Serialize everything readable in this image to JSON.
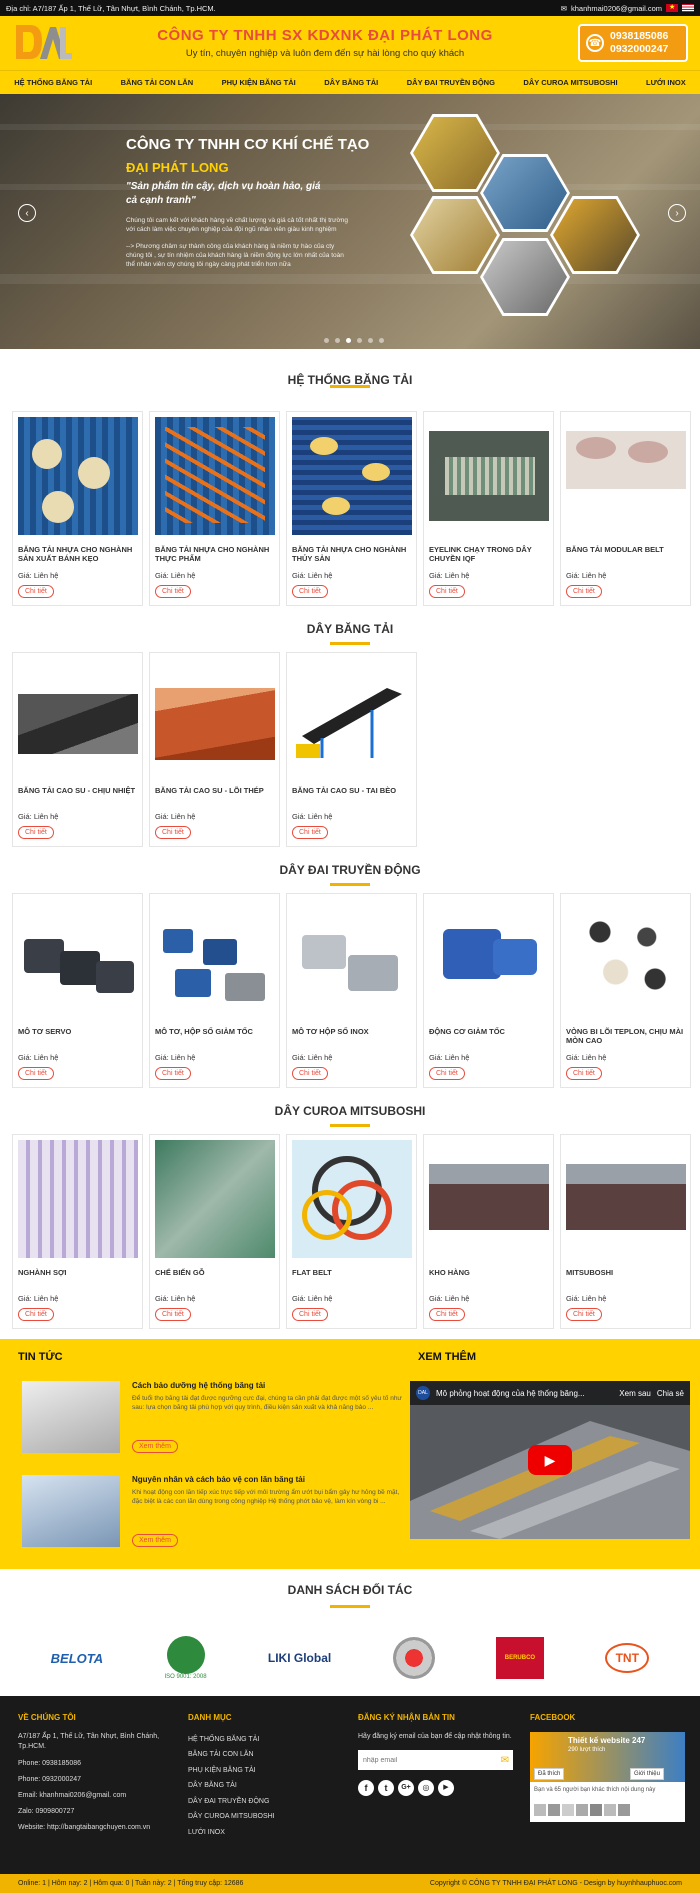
{
  "topbar": {
    "address": "Địa chỉ: A7/187 Ấp 1, Thế Lữ, Tân Nhựt, Bình Chánh, Tp.HCM.",
    "email": "khanhmai0206@gmail.com"
  },
  "header": {
    "logo_text": "DAL",
    "company": "CÔNG TY TNHH SX KDXNK ĐẠI PHÁT LONG",
    "slogan": "Uy tín, chuyên nghiệp và luôn đem đến sự hài lòng cho quý khách",
    "phone1": "0938185086",
    "phone2": "0932000247"
  },
  "nav": [
    "HỆ THỐNG BĂNG TẢI",
    "BĂNG TẢI CON LĂN",
    "PHỤ KIỆN BĂNG TẢI",
    "DÂY BĂNG TẢI",
    "DÂY ĐAI TRUYỀN ĐỘNG",
    "DÂY CUROA MITSUBOSHI",
    "LƯỚI INOX"
  ],
  "hero": {
    "title": "CÔNG TY TNHH CƠ KHÍ CHẾ TẠO",
    "subtitle": "ĐẠI PHÁT LONG",
    "quote": "\"Sản phẩm tin cậy, dịch vụ hoàn hảo, giá cả cạnh tranh\"",
    "p1": "Chúng tôi cam kết với khách hàng về chất lượng và giá cả tốt nhất thị trường với cách làm việc chuyên nghiệp của đội ngũ nhân viên giàu kinh nghiệm",
    "p2": "--> Phương châm sự thành công của khách hàng là niềm tự hào của cty chúng tôi , sự tín nhiệm của khách hàng là niềm động lực lớn nhất của toàn thể nhân viên cty chúng tôi ngày càng phát triển hơn nữa"
  },
  "price_label": "Giá: Liên hệ",
  "detail_label": "Chi tiết",
  "sections": [
    {
      "title": "HỆ THỐNG BĂNG TẢI",
      "items": [
        "BĂNG TẢI NHỰA CHO NGHÀNH SẢN XUẤT BÁNH KẸO",
        "BĂNG TẢI NHỰA CHO NGHÀNH THỰC PHẨM",
        "BĂNG TẢI NHỰA CHO NGHÀNH THỦY SẢN",
        "EYELINK CHẠY TRONG DÂY CHUYỀN IQF",
        "BĂNG TẢI MODULAR BELT"
      ]
    },
    {
      "title": "DÂY BĂNG TẢI",
      "items": [
        "BĂNG TẢI CAO SU - CHỊU NHIỆT",
        "BĂNG TẢI CAO SU - LÕI THÉP",
        "BĂNG TẢI CAO SU - TAI BÈO"
      ]
    },
    {
      "title": "DÂY ĐAI TRUYỀN ĐỘNG",
      "items": [
        "MÔ TƠ SERVO",
        "MÔ TƠ, HỘP SỐ GIẢM TỐC",
        "MÔ TƠ HỘP SỐ INOX",
        "ĐỘNG CƠ GIẢM TỐC",
        "VÒNG BI LÕI TEPLON, CHỊU MÀI MÒN CAO"
      ]
    },
    {
      "title": "DÂY CUROA MITSUBOSHI",
      "items": [
        "NGHÀNH SỢI",
        "CHẾ BIẾN GỖ",
        "FLAT BELT",
        "KHO HÀNG",
        "MITSUBOSHI"
      ]
    }
  ],
  "news": {
    "title": "TIN TỨC",
    "more": "XEM THÊM",
    "button": "Xem thêm",
    "items": [
      {
        "title": "Cách bảo dưỡng hệ thống băng tải",
        "desc": "Để tuổi thọ băng tải đạt được ngưỡng cực đại, chúng ta cần phải đạt được một số yêu tố như sau: lựa chọn băng tải phù hợp với quy trình, điều kiện sản xuất và khả năng bảo ..."
      },
      {
        "title": "Nguyên nhân và cách bảo vệ con lăn băng tải",
        "desc": "Khi hoạt động con lăn tiếp xúc trực tiếp với môi trường ẩm ướt bụi bẩm gây hư hỏng bề mặt, đặc biệt là các con lăn dùng trong công nghiệp Hệ thống phớt bảo vệ, làm kín vòng bi ..."
      }
    ],
    "video": {
      "title": "Mô phỏng hoạt động của hệ thống băng...",
      "watch_later": "Xem sau",
      "share": "Chia sẻ"
    }
  },
  "partners": {
    "title": "DANH SÁCH ĐỐI TÁC",
    "logos": [
      "BELOTA",
      "ISO 9001: 2008",
      "LIKI Global",
      "",
      "BERUBCO",
      "TNT"
    ]
  },
  "footer": {
    "about_title": "VỀ CHÚNG TÔI",
    "address": "A7/187 Ấp 1, Thế Lữ, Tân Nhựt, Bình Chánh, Tp.HCM.",
    "phone1": "Phone: 0938185086",
    "phone2": "Phone: 0932000247",
    "email": "Email: khanhmai0206@gmail. com",
    "zalo": "Zalo: 0909800727",
    "website": "Website: http://bangtaibangchuyen.com.vn",
    "menu_title": "DANH MỤC",
    "menu": [
      "HỆ THỐNG BĂNG TẢI",
      "BĂNG TẢI CON LĂN",
      "PHỤ KIỆN BĂNG TẢI",
      "DÂY BĂNG TẢI",
      "DÂY ĐAI TRUYỀN ĐỘNG",
      "DÂY CUROA MITSUBOSHI",
      "LƯỚI INOX"
    ],
    "news_title": "ĐĂNG KÝ NHẬN BẢN TIN",
    "news_text": "Hãy đăng ký email của bạn để cập nhật thông tin.",
    "news_placeholder": "nhập email",
    "fb_title": "FACEBOOK",
    "fb_name": "Thiết kế website 247",
    "fb_likes": "290 lượt thích",
    "fb_liked": "Đã thích",
    "fb_share": "Giới thiệu",
    "fb_friends": "Bạn và 65 người bạn khác thích nội dung này"
  },
  "bottom": {
    "stats": "Online: 1 | Hôm nay: 2 | Hôm qua: 0 | Tuần này: 2 | Tổng truy cập: 12686",
    "copyright": "Copyright © CÔNG TY TNHH ĐẠI PHÁT LONG - Design by huynhhauphuoc.com"
  }
}
